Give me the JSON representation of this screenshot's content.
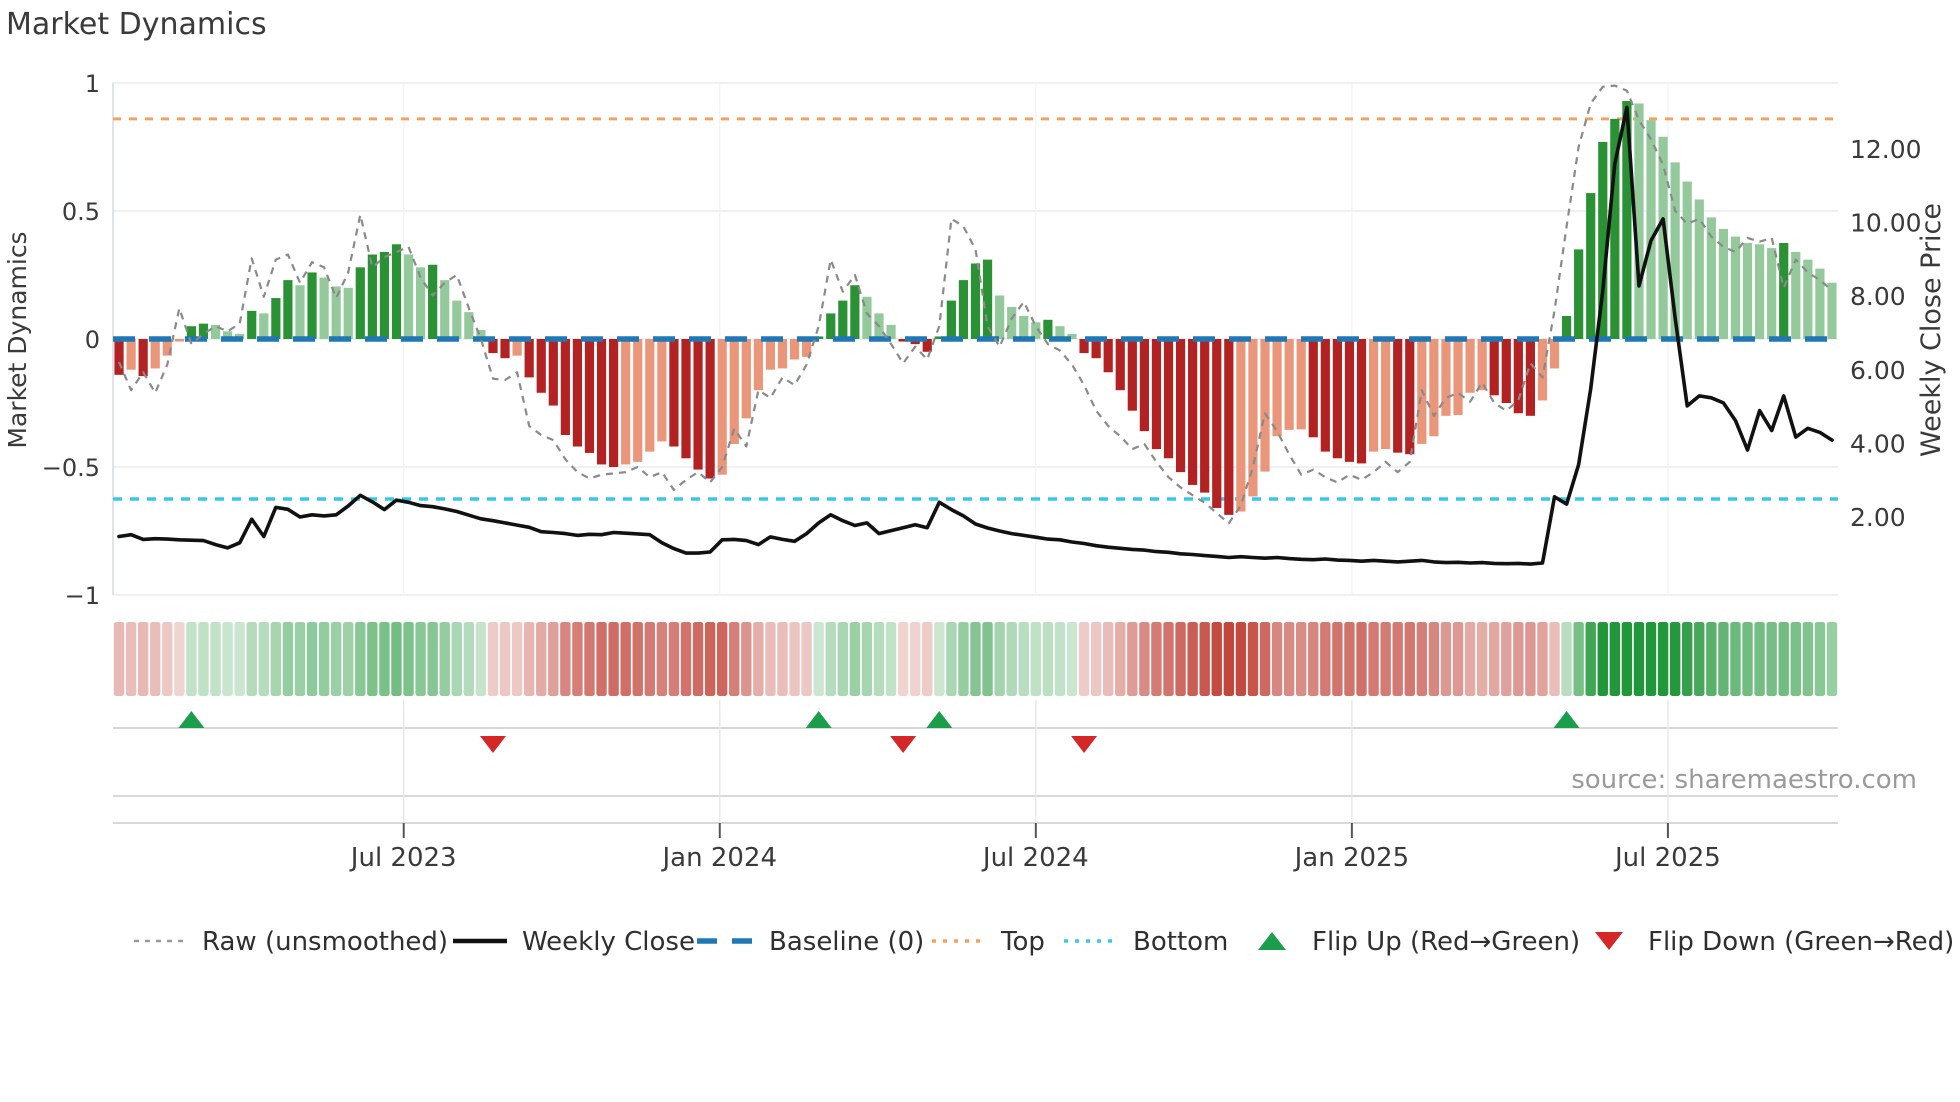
{
  "title": "Market Dynamics",
  "source_note": "source: sharemaestro.com",
  "y_axis_left": {
    "title": "Market Dynamics",
    "tick_labels": [
      "1",
      "0.5",
      "0",
      "−0.5",
      "−1"
    ],
    "tick_values": [
      1,
      0.5,
      0,
      -0.5,
      -1
    ]
  },
  "y_axis_right": {
    "title": "Weekly Close Price",
    "tick_labels": [
      "12.00",
      "10.00",
      "8.00",
      "6.00",
      "4.00",
      "2.00"
    ],
    "tick_values": [
      12,
      10,
      8,
      6,
      4,
      2
    ]
  },
  "x_axis": {
    "tick_labels": [
      "Jul 2023",
      "Jan 2024",
      "Jul 2024",
      "Jan 2025",
      "Jul 2025"
    ],
    "tick_week_index": [
      23.6,
      49.8,
      76.0,
      102.2,
      128.4
    ]
  },
  "legend": {
    "items": [
      {
        "label": "Raw (unsmoothed)",
        "swatch": "dashed-line",
        "color": "#999999"
      },
      {
        "label": "Weekly Close",
        "swatch": "solid-line",
        "color": "#111111"
      },
      {
        "label": "Baseline (0)",
        "swatch": "bold-dashed-line",
        "color": "#1f77b4"
      },
      {
        "label": "Top",
        "swatch": "dotted-line",
        "color": "#f2a45f"
      },
      {
        "label": "Bottom",
        "swatch": "dotted-line",
        "color": "#35c8e8"
      },
      {
        "label": "Flip Up (Red→Green)",
        "swatch": "triangle-up",
        "color": "#1b9e4b"
      },
      {
        "label": "Flip Down (Green→Red)",
        "swatch": "triangle-down",
        "color": "#d62728"
      }
    ]
  },
  "colors": {
    "bar_pos_strong": "#2a9235",
    "bar_pos_weak": "#94c99b",
    "bar_neg_strong": "#b22222",
    "bar_neg_weak": "#e9967a",
    "baseline_blue": "#1f77b4",
    "top_orange": "#f2a45f",
    "bottom_cyan": "#35c8e8",
    "raw_gray": "#8a8a8a",
    "price_black": "#111111",
    "flip_up_green": "#1b9e4b",
    "flip_down_red": "#d62728",
    "grid": "#e8ecf1",
    "vgrid": "#f2f4f7",
    "footer_line": "#cccccc",
    "text": "#3a3a3a",
    "source_text": "#9a9a9a",
    "heat_pos_rgb": [
      34,
      150,
      58
    ],
    "heat_neg_rgb": [
      192,
      68,
      58
    ]
  },
  "chart_data": {
    "type": "combo",
    "x_unit": "week",
    "week_count": 143,
    "ylim_left": [
      -1,
      1
    ],
    "right_axis_ticks": [
      2,
      4,
      6,
      8,
      10,
      12
    ],
    "reference_lines": {
      "baseline": 0,
      "top": 0.86,
      "bottom": -0.625
    },
    "momentum": [
      -0.14,
      -0.12,
      -0.145,
      -0.115,
      -0.065,
      -0.01,
      0.05,
      0.06,
      0.055,
      0.03,
      0.02,
      0.11,
      0.1,
      0.16,
      0.23,
      0.21,
      0.26,
      0.24,
      0.205,
      0.2,
      0.28,
      0.33,
      0.34,
      0.37,
      0.33,
      0.28,
      0.29,
      0.23,
      0.15,
      0.105,
      0.035,
      -0.055,
      -0.075,
      -0.065,
      -0.15,
      -0.21,
      -0.26,
      -0.375,
      -0.42,
      -0.445,
      -0.49,
      -0.5,
      -0.49,
      -0.48,
      -0.44,
      -0.4,
      -0.42,
      -0.466,
      -0.51,
      -0.545,
      -0.53,
      -0.41,
      -0.31,
      -0.2,
      -0.12,
      -0.115,
      -0.08,
      -0.07,
      0.01,
      0.1,
      0.15,
      0.21,
      0.165,
      0.1,
      0.055,
      -0.01,
      -0.02,
      -0.05,
      0.01,
      0.15,
      0.23,
      0.295,
      0.31,
      0.17,
      0.125,
      0.09,
      0.065,
      0.075,
      0.05,
      0.02,
      -0.055,
      -0.075,
      -0.13,
      -0.2,
      -0.28,
      -0.36,
      -0.43,
      -0.466,
      -0.52,
      -0.57,
      -0.6,
      -0.66,
      -0.687,
      -0.674,
      -0.615,
      -0.518,
      -0.38,
      -0.355,
      -0.353,
      -0.384,
      -0.44,
      -0.466,
      -0.48,
      -0.486,
      -0.44,
      -0.43,
      -0.444,
      -0.45,
      -0.41,
      -0.38,
      -0.3,
      -0.297,
      -0.21,
      -0.2,
      -0.22,
      -0.25,
      -0.29,
      -0.3,
      -0.24,
      -0.115,
      0.09,
      0.35,
      0.57,
      0.77,
      0.86,
      0.93,
      0.92,
      0.855,
      0.79,
      0.69,
      0.615,
      0.545,
      0.475,
      0.43,
      0.4,
      0.375,
      0.37,
      0.355,
      0.375,
      0.34,
      0.31,
      0.275,
      0.22
    ],
    "raw": [
      -0.09,
      -0.2,
      -0.13,
      -0.21,
      -0.1,
      0.12,
      -0.02,
      0.02,
      0.05,
      0.03,
      0.06,
      0.315,
      0.165,
      0.31,
      0.33,
      0.22,
      0.3,
      0.28,
      0.16,
      0.26,
      0.485,
      0.28,
      0.32,
      0.34,
      0.36,
      0.24,
      0.17,
      0.22,
      0.25,
      0.12,
      0.0,
      -0.155,
      -0.16,
      -0.13,
      -0.34,
      -0.375,
      -0.395,
      -0.47,
      -0.52,
      -0.545,
      -0.53,
      -0.525,
      -0.52,
      -0.5,
      -0.54,
      -0.52,
      -0.59,
      -0.55,
      -0.52,
      -0.56,
      -0.5,
      -0.35,
      -0.42,
      -0.2,
      -0.23,
      -0.15,
      -0.18,
      -0.1,
      0.05,
      0.31,
      0.185,
      0.25,
      0.1,
      0.05,
      -0.02,
      -0.095,
      -0.03,
      -0.08,
      0.05,
      0.47,
      0.44,
      0.35,
      0.05,
      -0.03,
      0.08,
      0.145,
      0.05,
      -0.02,
      -0.045,
      -0.1,
      -0.18,
      -0.28,
      -0.34,
      -0.38,
      -0.43,
      -0.41,
      -0.48,
      -0.54,
      -0.58,
      -0.61,
      -0.64,
      -0.68,
      -0.72,
      -0.65,
      -0.5,
      -0.29,
      -0.36,
      -0.45,
      -0.53,
      -0.51,
      -0.54,
      -0.56,
      -0.53,
      -0.55,
      -0.52,
      -0.48,
      -0.52,
      -0.48,
      -0.2,
      -0.3,
      -0.23,
      -0.21,
      -0.245,
      -0.17,
      -0.25,
      -0.28,
      -0.24,
      -0.095,
      -0.15,
      0.11,
      0.44,
      0.75,
      0.92,
      0.985,
      0.99,
      0.97,
      0.855,
      0.78,
      0.68,
      0.5,
      0.45,
      0.47,
      0.4,
      0.36,
      0.34,
      0.395,
      0.38,
      0.395,
      0.2,
      0.31,
      0.26,
      0.23,
      0.19
    ],
    "price": [
      1.47,
      1.52,
      1.39,
      1.41,
      1.4,
      1.38,
      1.37,
      1.36,
      1.25,
      1.16,
      1.3,
      1.94,
      1.47,
      2.26,
      2.21,
      2.0,
      2.06,
      2.03,
      2.06,
      2.3,
      2.59,
      2.41,
      2.2,
      2.46,
      2.4,
      2.31,
      2.28,
      2.22,
      2.15,
      2.05,
      1.95,
      1.9,
      1.84,
      1.78,
      1.72,
      1.6,
      1.58,
      1.55,
      1.5,
      1.53,
      1.52,
      1.58,
      1.56,
      1.54,
      1.52,
      1.3,
      1.14,
      1.02,
      1.02,
      1.05,
      1.38,
      1.39,
      1.36,
      1.25,
      1.46,
      1.39,
      1.34,
      1.55,
      1.84,
      2.06,
      1.9,
      1.77,
      1.84,
      1.55,
      1.63,
      1.71,
      1.79,
      1.71,
      2.4,
      2.2,
      2.03,
      1.81,
      1.7,
      1.62,
      1.55,
      1.5,
      1.45,
      1.4,
      1.38,
      1.32,
      1.28,
      1.22,
      1.18,
      1.15,
      1.12,
      1.1,
      1.06,
      1.04,
      1.0,
      0.98,
      0.95,
      0.93,
      0.9,
      0.92,
      0.9,
      0.88,
      0.9,
      0.87,
      0.85,
      0.84,
      0.86,
      0.83,
      0.82,
      0.8,
      0.82,
      0.8,
      0.78,
      0.8,
      0.82,
      0.78,
      0.76,
      0.77,
      0.75,
      0.76,
      0.74,
      0.73,
      0.74,
      0.72,
      0.75,
      2.55,
      2.35,
      3.42,
      5.48,
      8.15,
      11.6,
      13.13,
      8.28,
      9.51,
      10.1,
      7.4,
      5.02,
      5.29,
      5.24,
      5.1,
      4.62,
      3.82,
      4.89,
      4.35,
      5.29,
      4.17,
      4.41,
      4.3,
      4.09
    ],
    "flip_up_weeks": [
      6,
      58,
      68,
      120
    ],
    "flip_down_weeks": [
      31,
      65,
      80
    ],
    "heatmap": {
      "source": "momentum",
      "description": "color strip below plot, red for negative weeks, green for positive weeks, intensity by magnitude"
    },
    "bar_shading_rule": "strong color when |value| grows or sign flips, pale color when momentum weakens"
  }
}
